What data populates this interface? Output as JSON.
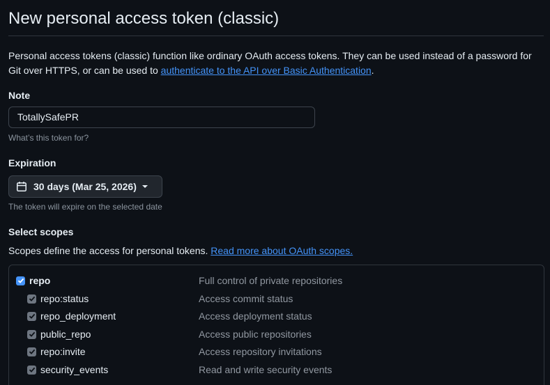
{
  "page": {
    "title": "New personal access token (classic)",
    "intro_text": "Personal access tokens (classic) function like ordinary OAuth access tokens. They can be used instead of a password for Git over HTTPS, or can be used to ",
    "intro_link": "authenticate to the API over Basic Authentication",
    "intro_end": "."
  },
  "note": {
    "label": "Note",
    "value": "TotallySafePR",
    "hint": "What’s this token for?"
  },
  "expiration": {
    "label": "Expiration",
    "selected": "30 days (Mar 25, 2026)",
    "hint": "The token will expire on the selected date"
  },
  "scopes": {
    "label": "Select scopes",
    "description": "Scopes define the access for personal tokens. ",
    "link": "Read more about OAuth scopes.",
    "items": [
      {
        "name": "repo",
        "description": "Full control of private repositories",
        "checked": true,
        "level": "main"
      },
      {
        "name": "repo:status",
        "description": "Access commit status",
        "checked": true,
        "level": "sub"
      },
      {
        "name": "repo_deployment",
        "description": "Access deployment status",
        "checked": true,
        "level": "sub"
      },
      {
        "name": "public_repo",
        "description": "Access public repositories",
        "checked": true,
        "level": "sub"
      },
      {
        "name": "repo:invite",
        "description": "Access repository invitations",
        "checked": true,
        "level": "sub"
      },
      {
        "name": "security_events",
        "description": "Read and write security events",
        "checked": true,
        "level": "sub"
      }
    ]
  },
  "colors": {
    "background": "#0d1117",
    "link": "#4493f8",
    "checkbox_checked": "#4493f8",
    "checkbox_inherited": "#6e7681"
  },
  "icons": {
    "calendar": "calendar-icon",
    "caret": "triangle-down-icon",
    "check": "check-icon"
  }
}
